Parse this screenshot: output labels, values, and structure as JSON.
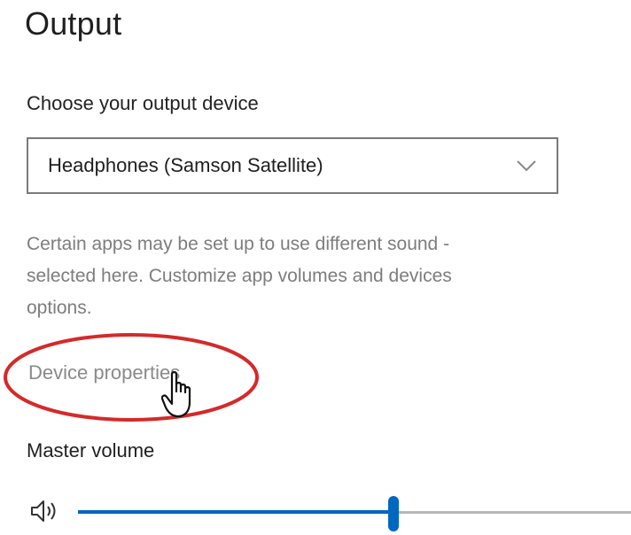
{
  "output": {
    "title": "Output",
    "choose_label": "Choose your output device",
    "device_selected": "Headphones (Samson Satellite)",
    "description_lines": [
      "Certain apps may be set up to use different sound -",
      "selected here. Customize app volumes and devices",
      "options."
    ],
    "device_properties_link": "Device properties",
    "master_volume_label": "Master volume",
    "master_volume_level": 0.57
  },
  "icons": {
    "dropdown": "chevron-down-icon",
    "speaker": "speaker-icon",
    "cursor": "hand-cursor-icon"
  },
  "colors": {
    "accent": "#0067c0",
    "annotation": "#d42a2a",
    "secondary_text": "#7d7d7d"
  }
}
